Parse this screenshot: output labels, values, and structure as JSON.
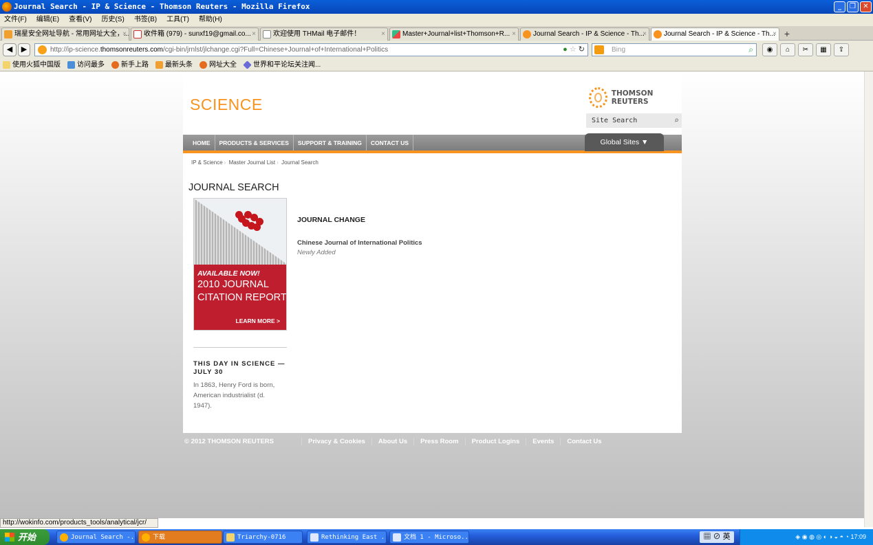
{
  "window": {
    "title": "Journal Search - IP & Science - Thomson Reuters - Mozilla Firefox"
  },
  "menu": [
    "文件(F)",
    "编辑(E)",
    "查看(V)",
    "历史(S)",
    "书签(B)",
    "工具(T)",
    "帮助(H)"
  ],
  "tabs": [
    {
      "label": "瑞星安全网址导航 - 常用网址大全，..."
    },
    {
      "label": "收件箱 (979) - sunxf19@gmail.co..."
    },
    {
      "label": "欢迎使用 THMail 电子邮件！"
    },
    {
      "label": "Master+Journal+list+Thomson+R..."
    },
    {
      "label": "Journal Search - IP & Science - Th..."
    },
    {
      "label": "Journal Search - IP & Science - Th..."
    }
  ],
  "url": {
    "prefix": "http://ip-science.",
    "domain": "thomsonreuters.com",
    "path": "/cgi-bin/jrnlst/jlchange.cgi?Full=Chinese+Journal+of+International+Politics"
  },
  "search": {
    "placeholder": "Bing"
  },
  "bookmarks": [
    "使用火狐中国版",
    "访问最多",
    "新手上路",
    "最新头条",
    "网址大全",
    "世界和平论坛关注闻..."
  ],
  "site": {
    "logo": "SCIENCE",
    "brand": "THOMSON REUTERS",
    "site_search": "Site Search",
    "nav": [
      "HOME",
      "PRODUCTS & SERVICES",
      "SUPPORT & TRAINING",
      "CONTACT US"
    ],
    "global_sites": "Global Sites ▼",
    "breadcrumb": [
      "IP & Science",
      "Master Journal List",
      "Journal Search"
    ],
    "heading": "JOURNAL SEARCH",
    "ad": {
      "available": "AVAILABLE NOW!",
      "line1": "2010 JOURNAL",
      "line2": "CITATION REPORTS",
      "more": "LEARN MORE >"
    },
    "day": {
      "heading": "THIS DAY IN SCIENCE — JULY 30",
      "text": "In 1863, Henry Ford is born, American industrialist (d. 1947)."
    },
    "journal_change": "JOURNAL CHANGE",
    "journal_name": "Chinese Journal of International Politics",
    "journal_status": "Newly Added",
    "footer": {
      "copyright": "© 2012 THOMSON REUTERS",
      "links": [
        "Privacy & Cookies",
        "About Us",
        "Press Room",
        "Product Logins",
        "Events",
        "Contact Us"
      ]
    }
  },
  "status_url": "http://wokinfo.com/products_tools/analytical/jcr/",
  "taskbar": {
    "start": "开始",
    "tasks": [
      "Journal Search -...",
      "下载",
      "Triarchy-0716",
      "Rethinking East ...",
      "文档 1 - Microso..."
    ],
    "ime": "英",
    "clock": "17:09"
  },
  "colors": {
    "accent": "#f7931e",
    "ad_red": "#be1e2d",
    "nav_gray": "#8c8c8c"
  }
}
